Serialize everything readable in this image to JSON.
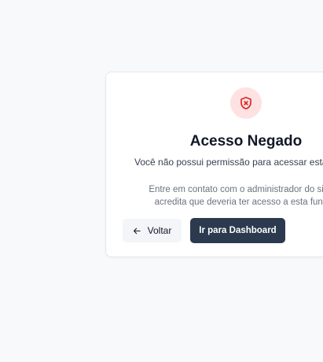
{
  "card": {
    "title": "Acesso Negado",
    "subtitle": "Você não possui permissão para acessar esta",
    "info_line_1": "Entre em contato com o administrador do sistem",
    "info_line_2": "acredita que deveria ter acesso a esta funcior",
    "back_label": "Voltar",
    "dashboard_label": "Ir para Dashboard",
    "icon": "shield-x-icon",
    "back_icon": "arrow-left-icon"
  },
  "colors": {
    "background": "#f8f9fb",
    "icon_circle": "#fee2e2",
    "icon_stroke": "#dc2626",
    "primary_button": "#2b3a4e",
    "secondary_button": "#f3f5f8"
  }
}
